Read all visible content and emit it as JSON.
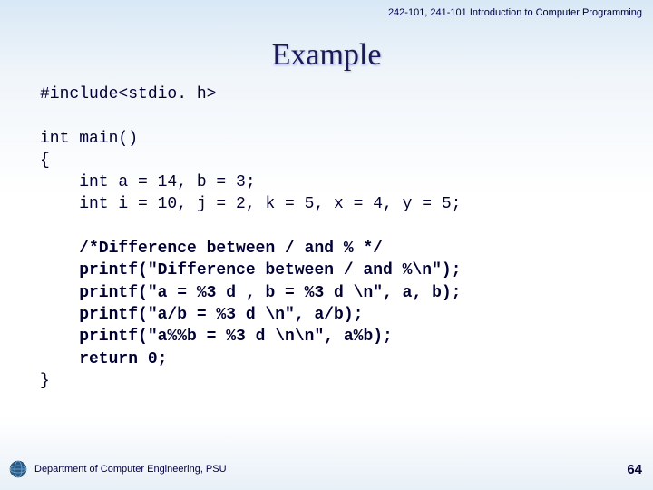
{
  "header": "242-101, 241-101 Introduction to Computer Programming",
  "title": "Example",
  "code": {
    "l1": "#include<stdio. h>",
    "l2": "",
    "l3": "int main()",
    "l4": "{",
    "l5": "    int a = 14, b = 3;",
    "l6": "    int i = 10, j = 2, k = 5, x = 4, y = 5;",
    "l7": "",
    "l8": "    /*Difference between / and % */",
    "l9": "    printf(\"Difference between / and %\\n\");",
    "l10": "    printf(\"a = %3 d , b = %3 d \\n\", a, b);",
    "l11": "    printf(\"a/b = %3 d \\n\", a/b);",
    "l12": "    printf(\"a%%b = %3 d \\n\\n\", a%b);",
    "l13": "    return 0;",
    "l14": "}"
  },
  "footer": {
    "dept": "Department of Computer Engineering, PSU",
    "page": "64"
  }
}
